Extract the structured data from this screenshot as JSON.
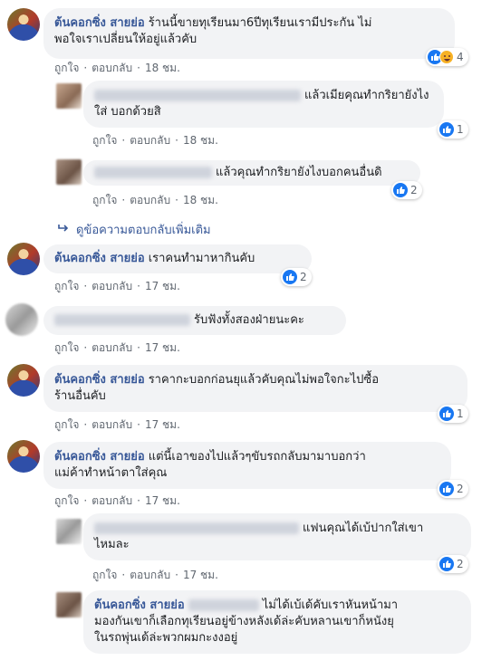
{
  "labels": {
    "like": "ถูกใจ",
    "reply": "ตอบกลับ",
    "dot": "·"
  },
  "comments": [
    {
      "author": "ต้นคอกซิ่ง สายย่อ",
      "line1": "ร้านนี้ขายทุเรียนมา6ปีทุเรียนเรามีประกัน ไม่",
      "line2": "พอใจเราเปลี่ยนให้อยู่แล้วคับ",
      "time": "18 ชม.",
      "reaction_count": "4"
    },
    {
      "line1": "แล้วเมียคุณทำกริยายังไง",
      "line2": "ใส่ บอกด้วยสิ",
      "time": "18 ชม.",
      "reaction_count": "1"
    },
    {
      "line1": "แล้วคุณทำกริยายังไงบอกคนอื่นดิ",
      "time": "18 ชม.",
      "reaction_count": "2"
    },
    {
      "author": "ต้นคอกซิ่ง สายย่อ",
      "line1": "เราคนทำมาหากินคับ",
      "time": "17 ชม.",
      "reaction_count": "2"
    },
    {
      "line1": "รับฟังทั้งสองฝ่ายนะคะ",
      "time": "17 ชม."
    },
    {
      "author": "ต้นคอกซิ่ง สายย่อ",
      "line1": "ราคากะบอกก่อนยุแล้วคับคุณไม่พอใจกะไปซื้อ",
      "line2": "ร้านอื่นคับ",
      "time": "17 ชม.",
      "reaction_count": "1"
    },
    {
      "author": "ต้นคอกซิ่ง สายย่อ",
      "line1": "แต่นี้เอาของไปแล้วๆขับรถกลับมามาบอกว่า",
      "line2": "แม่ค้าทำหน้าตาใส่คุณ",
      "time": "17 ชม.",
      "reaction_count": "2"
    },
    {
      "line1": "แฟนคุณได้เบ้ปากใส่เขา",
      "line2": "ไหมละ",
      "time": "17 ชม.",
      "reaction_count": "2"
    },
    {
      "author": "ต้นคอกซิ่ง สายย่อ",
      "line1": "ไม่ได้เบ้เด้คับเราหันหน้ามา",
      "line2": "มองกันเขาก็เลือกทุเรียนอยู่ข้างหลังเด้ล่ะคับหลานเขาก็หนังยุ",
      "line3": "ในรถพุ่นเด้ล่ะพวกผมกะงงอยู่"
    }
  ],
  "more_replies": "ดูข้อความตอบกลับเพิ่มเติม",
  "colors": {
    "link": "#385898",
    "like": "#1877f2",
    "bubble": "#f2f3f5"
  }
}
